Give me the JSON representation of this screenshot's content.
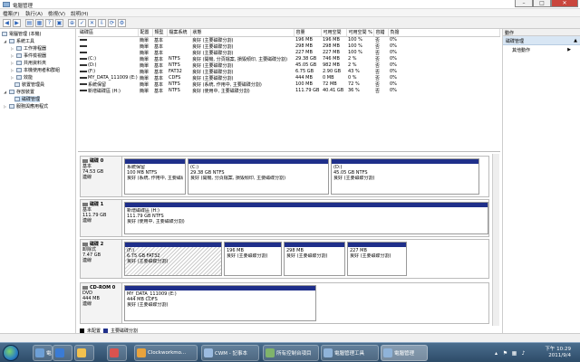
{
  "window": {
    "title": "電腦管理"
  },
  "menu": [
    "檔案(F)",
    "執行(A)",
    "檢視(V)",
    "說明(H)"
  ],
  "tree": [
    {
      "label": "電腦管理 (本機)",
      "level": 0,
      "icon": "computer-management-icon"
    },
    {
      "label": "系統工具",
      "level": 1,
      "icon": "tools-icon"
    },
    {
      "label": "工作排程器",
      "level": 2,
      "icon": "clock-icon"
    },
    {
      "label": "事件檢視器",
      "level": 2,
      "icon": "event-icon"
    },
    {
      "label": "共用資料夾",
      "level": 2,
      "icon": "folder-icon"
    },
    {
      "label": "本機使用者和群組",
      "level": 2,
      "icon": "users-icon"
    },
    {
      "label": "效能",
      "level": 2,
      "icon": "performance-icon"
    },
    {
      "label": "裝置管理員",
      "level": 2,
      "icon": "device-icon"
    },
    {
      "label": "存放裝置",
      "level": 1,
      "icon": "storage-icon"
    },
    {
      "label": "磁碟管理",
      "level": 2,
      "icon": "disk-icon",
      "selected": true
    },
    {
      "label": "服務與應用程式",
      "level": 1,
      "icon": "services-icon"
    }
  ],
  "volume_table": {
    "headers": [
      "磁碟區",
      "配置",
      "類型",
      "檔案系統",
      "狀態",
      "容量",
      "可用空間",
      "可用空間 %",
      "容錯",
      "負擔"
    ],
    "rows": [
      [
        "",
        "簡單",
        "基本",
        "",
        "良好 (主要磁碟分割)",
        "196 MB",
        "196 MB",
        "100 %",
        "否",
        "0%"
      ],
      [
        "",
        "簡單",
        "基本",
        "",
        "良好 (主要磁碟分割)",
        "298 MB",
        "298 MB",
        "100 %",
        "否",
        "0%"
      ],
      [
        "",
        "簡單",
        "基本",
        "",
        "良好 (主要磁碟分割)",
        "227 MB",
        "227 MB",
        "100 %",
        "否",
        "0%"
      ],
      [
        "(C:)",
        "簡單",
        "基本",
        "NTFS",
        "良好 (開機, 分頁檔案, 損毀傾印, 主要磁碟分割)",
        "29.38 GB",
        "746 MB",
        "2 %",
        "否",
        "0%"
      ],
      [
        "(D:)",
        "簡單",
        "基本",
        "NTFS",
        "良好 (主要磁碟分割)",
        "45.05 GB",
        "982 MB",
        "2 %",
        "否",
        "0%"
      ],
      [
        "(F:)",
        "簡單",
        "基本",
        "FAT32",
        "良好 (主要磁碟分割)",
        "6.75 GB",
        "2.90 GB",
        "43 %",
        "否",
        "0%"
      ],
      [
        "MY_DATA_111009 (E:)",
        "簡單",
        "基本",
        "CDFS",
        "良好 (主要磁碟分割)",
        "444 MB",
        "0 MB",
        "0 %",
        "否",
        "0%"
      ],
      [
        "系統保留",
        "簡單",
        "基本",
        "NTFS",
        "良好 (系統, 作用中, 主要磁碟分割)",
        "100 MB",
        "72 MB",
        "72 %",
        "否",
        "0%"
      ],
      [
        "新增磁碟區 (H:)",
        "簡單",
        "基本",
        "NTFS",
        "良好 (使用中, 主要磁碟分割)",
        "111.79 GB",
        "40.41 GB",
        "36 %",
        "否",
        "0%"
      ]
    ]
  },
  "disks": [
    {
      "name": "磁碟 0",
      "type": "基本",
      "size": "74.53 GB",
      "status": "連線",
      "partitions": [
        {
          "name": "系統保留",
          "info": "100 MB NTFS",
          "status": "良好 (系統, 作用中, 主要磁碟分割)"
        },
        {
          "name": "(C:)",
          "info": "29.38 GB NTFS",
          "status": "良好 (開機, 分頁檔案, 損毀傾印, 主要磁碟分割)"
        },
        {
          "name": "(D:)",
          "info": "45.05 GB NTFS",
          "status": "良好 (主要磁碟分割)"
        }
      ]
    },
    {
      "name": "磁碟 1",
      "type": "基本",
      "size": "111.79 GB",
      "status": "連線",
      "partitions": [
        {
          "name": "新增磁碟區 (H:)",
          "info": "111.79 GB NTFS",
          "status": "良好 (使用中, 主要磁碟分割)"
        }
      ]
    },
    {
      "name": "磁碟 2",
      "type": "卸除式",
      "size": "7.47 GB",
      "status": "連線",
      "partitions": [
        {
          "name": "(F:)",
          "info": "6.75 GB FAT32",
          "status": "良好 (主要磁碟分割)"
        },
        {
          "name": "",
          "info": "196 MB",
          "status": "良好 (主要磁碟分割)"
        },
        {
          "name": "",
          "info": "298 MB",
          "status": "良好 (主要磁碟分割)"
        },
        {
          "name": "",
          "info": "227 MB",
          "status": "良好 (主要磁碟分割)"
        }
      ]
    },
    {
      "name": "CD-ROM 0",
      "type": "DVD",
      "size": "444 MB",
      "status": "連線",
      "partitions": [
        {
          "name": "MY_DATA_111009 (E:)",
          "info": "444 MB CDFS",
          "status": "良好 (主要磁碟分割)"
        }
      ]
    }
  ],
  "legend": [
    {
      "label": "未配置",
      "color": "#000000"
    },
    {
      "label": "主要磁碟分割",
      "color": "#1f2f8a"
    }
  ],
  "actions": {
    "header": "動作",
    "section": "磁碟管理",
    "more": "其他動作"
  },
  "taskbar": {
    "tasks": [
      {
        "label": "電腦",
        "color": "#6d9fd6",
        "icon": "computer-icon"
      },
      {
        "label": "",
        "color": "#3a7bd5",
        "icon": "ie-icon"
      },
      {
        "label": "",
        "color": "#f2c14e",
        "icon": "folder-icon"
      },
      {
        "label": "",
        "color": "#d9534f",
        "icon": "media-icon"
      },
      {
        "label": "Clockworkmo...",
        "color": "#e8a33d",
        "icon": "chrome-icon"
      },
      {
        "label": "CWM - 記事本",
        "color": "#9bbbe0",
        "icon": "notepad-icon"
      },
      {
        "label": "所有控制台項目",
        "color": "#7fb36b",
        "icon": "control-panel-icon"
      },
      {
        "label": "電腦管理工具",
        "color": "#8fb3d9",
        "icon": "admin-tools-icon"
      },
      {
        "label": "電腦管理",
        "color": "#8fb3d9",
        "icon": "computer-management-icon",
        "active": true
      }
    ],
    "time": "下午 10:29",
    "date": "2011/9/4"
  }
}
